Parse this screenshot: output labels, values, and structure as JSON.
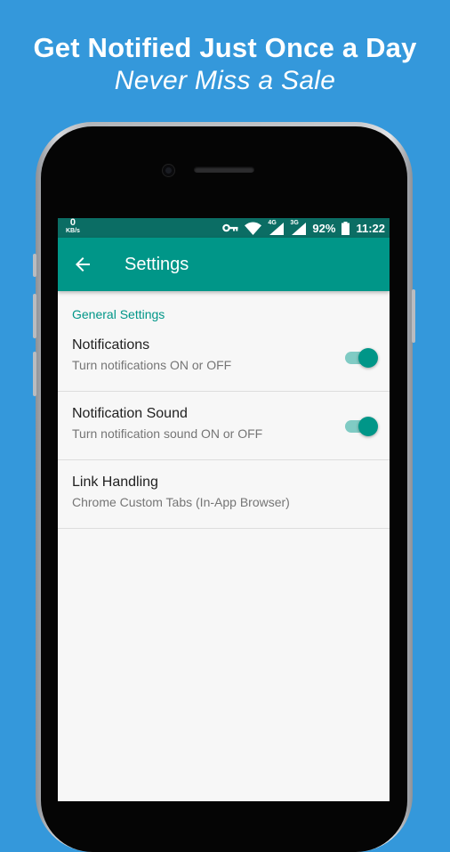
{
  "promo": {
    "headline": "Get Notified Just Once a Day",
    "tagline": "Never Miss a Sale"
  },
  "status_bar": {
    "speed_value": "0",
    "speed_unit": "KB/s",
    "network_4g": "4G",
    "network_3g": "3G",
    "battery": "92%",
    "time": "11:22"
  },
  "app_bar": {
    "title": "Settings"
  },
  "settings": {
    "section_title": "General Settings",
    "items": [
      {
        "title": "Notifications",
        "summary": "Turn notifications ON or OFF",
        "enabled": true
      },
      {
        "title": "Notification Sound",
        "summary": "Turn notification sound ON or OFF",
        "enabled": true
      },
      {
        "title": "Link Handling",
        "summary": "Chrome Custom Tabs (In-App Browser)"
      }
    ]
  },
  "colors": {
    "background": "#3498db",
    "primary": "#009688",
    "primary_dark": "#0b6d64",
    "switch_track": "#80cbc4"
  },
  "icons": {
    "back": "arrow-back-icon",
    "key": "vpn-key-icon",
    "wifi": "wifi-icon",
    "signal": "cell-signal-icon",
    "battery": "battery-icon"
  }
}
